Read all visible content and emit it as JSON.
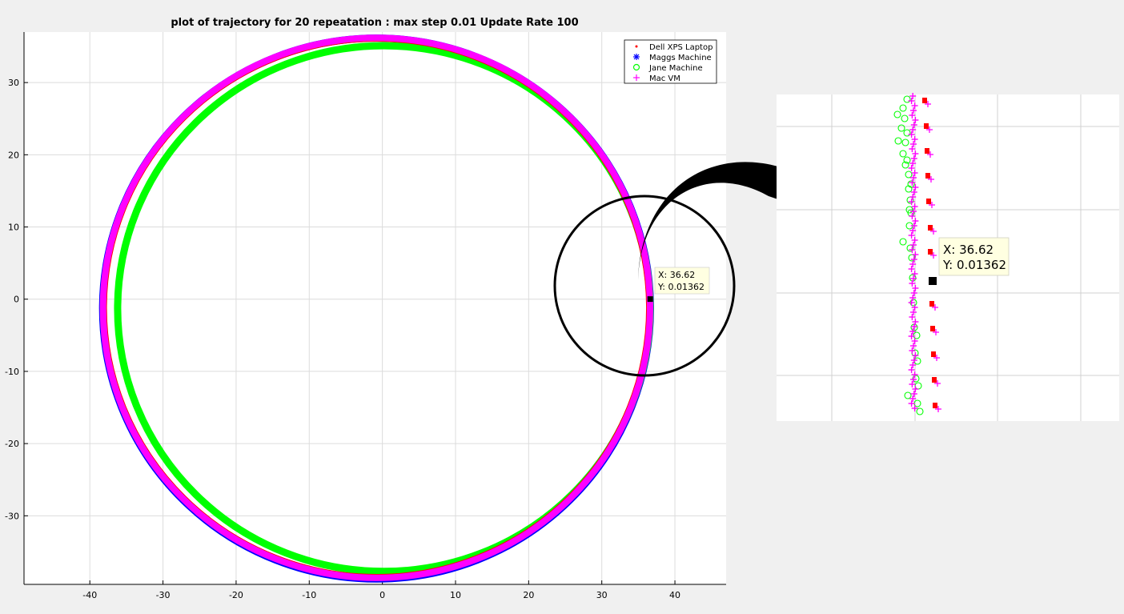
{
  "chart_data": [
    {
      "type": "scatter",
      "title": "plot of trajectory for 20 repeatation : max step 0.01 Update Rate 100",
      "xlabel": "",
      "ylabel": "",
      "xlim": [
        -49,
        47
      ],
      "ylim": [
        -39.5,
        37
      ],
      "xticks": [
        -40,
        -30,
        -20,
        -10,
        0,
        10,
        20,
        30,
        40
      ],
      "yticks": [
        30,
        20,
        10,
        0,
        -10,
        -20,
        -30
      ],
      "grid": true,
      "legend_position": "top-right",
      "series": [
        {
          "name": "Dell XPS Laptop",
          "marker": "dot",
          "color": "#ff0000",
          "circle": {
            "cx": -0.8,
            "cy": -1.2,
            "r": 37.3
          }
        },
        {
          "name": "Maggs Machine",
          "marker": "asterisk",
          "color": "#0000ff",
          "circle": {
            "cx": -0.8,
            "cy": -1.3,
            "r": 37.45
          }
        },
        {
          "name": "Jane Machine",
          "marker": "circle",
          "color": "#00ff00",
          "circle": {
            "cx": 0.2,
            "cy": -1.3,
            "r": 36.4
          }
        },
        {
          "name": "Mac VM",
          "marker": "plus",
          "color": "#ff00ff",
          "circle": {
            "cx": -0.8,
            "cy": -1.2,
            "r": 37.4
          }
        }
      ],
      "datatip": {
        "x_label": "X: 36.62",
        "y_label": "Y: 0.01362",
        "x": 36.62,
        "y": 0.01362
      }
    }
  ],
  "inset": {
    "datatip": {
      "x_label": "X: 36.62",
      "y_label": "Y: 0.01362"
    }
  },
  "colors": {
    "page_background": "#f0f0f0",
    "axes_background": "#ffffff",
    "grid": "#dcdcdc",
    "datatip_background": "#ffffe1"
  }
}
